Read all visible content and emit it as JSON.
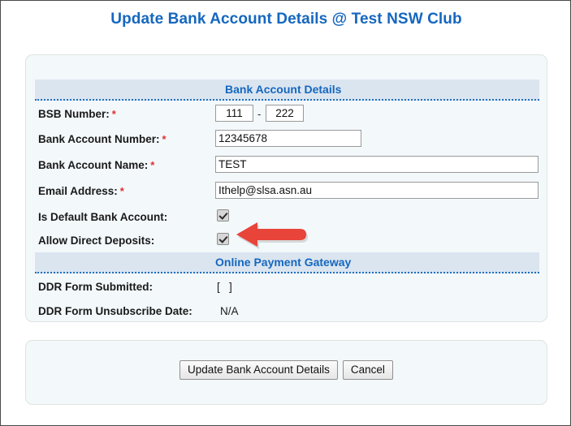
{
  "page": {
    "title": "Update Bank Account Details @ Test NSW Club"
  },
  "sections": {
    "bank_account": {
      "heading": "Bank Account Details",
      "fields": {
        "bsb_label": "BSB Number:",
        "bsb_part1": "111",
        "bsb_separator": "-",
        "bsb_part2": "222",
        "account_number_label": "Bank Account Number:",
        "account_number_value": "12345678",
        "account_name_label": "Bank Account Name:",
        "account_name_value": "TEST",
        "email_label": "Email Address:",
        "email_value": "Ithelp@slsa.asn.au",
        "is_default_label": "Is Default Bank Account:",
        "is_default_checked": true,
        "allow_direct_deposits_label": "Allow Direct Deposits:",
        "allow_direct_deposits_checked": true
      },
      "required_marker": "*"
    },
    "online_payment_gateway": {
      "heading": "Online Payment Gateway",
      "fields": {
        "ddr_submitted_label": "DDR Form Submitted:",
        "ddr_submitted_value": "[   ]",
        "ddr_unsubscribe_label": "DDR Form Unsubscribe Date:",
        "ddr_unsubscribe_value": "N/A"
      }
    }
  },
  "actions": {
    "submit_label": "Update Bank Account Details",
    "cancel_label": "Cancel"
  },
  "annotation": {
    "arrow_direction": "left",
    "arrow_color": "#e8443a",
    "points_at": "allow-direct-deposits-checkbox"
  },
  "colors": {
    "title_blue": "#1567bf",
    "band_background": "#dbe5f0",
    "panel_background": "#f3f8fb",
    "required_red": "#e03030"
  }
}
